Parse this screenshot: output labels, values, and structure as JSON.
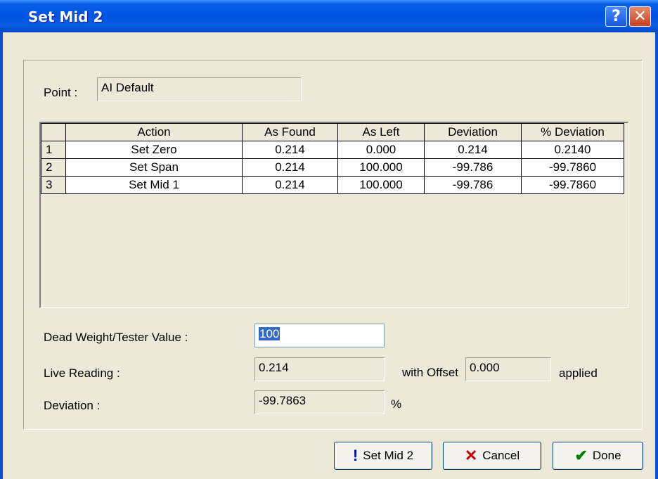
{
  "window": {
    "title": "Set Mid 2"
  },
  "point": {
    "label": "Point :",
    "value": "AI Default"
  },
  "table": {
    "headers": [
      "",
      "Action",
      "As Found",
      "As Left",
      "Deviation",
      "% Deviation"
    ],
    "rows": [
      [
        "1",
        "Set Zero",
        "0.214",
        "0.000",
        "0.214",
        "0.2140"
      ],
      [
        "2",
        "Set Span",
        "0.214",
        "100.000",
        "-99.786",
        "-99.7860"
      ],
      [
        "3",
        "Set Mid 1",
        "0.214",
        "100.000",
        "-99.786",
        "-99.7860"
      ]
    ]
  },
  "dead_weight": {
    "label": "Dead Weight/Tester Value :",
    "value": "100"
  },
  "live_reading": {
    "label": "Live Reading :",
    "value": "0.214",
    "offset_label": "with Offset",
    "offset_value": "0.000",
    "applied_label": "applied"
  },
  "deviation": {
    "label": "Deviation :",
    "value": "-99.7863",
    "unit": "%"
  },
  "buttons": {
    "set_mid": {
      "label": "Set Mid 2",
      "icon": "exclamation-icon"
    },
    "cancel": {
      "label": "Cancel",
      "icon": "x-icon"
    },
    "done": {
      "label": "Done",
      "icon": "checkmark-icon"
    }
  },
  "colors": {
    "title_bar": "#0054E3",
    "dialog_bg": "#ECE9D8",
    "selection": "#316AC5",
    "cancel_icon": "#C00000",
    "done_icon": "#008000",
    "set_mid_icon": "#0000C0"
  }
}
